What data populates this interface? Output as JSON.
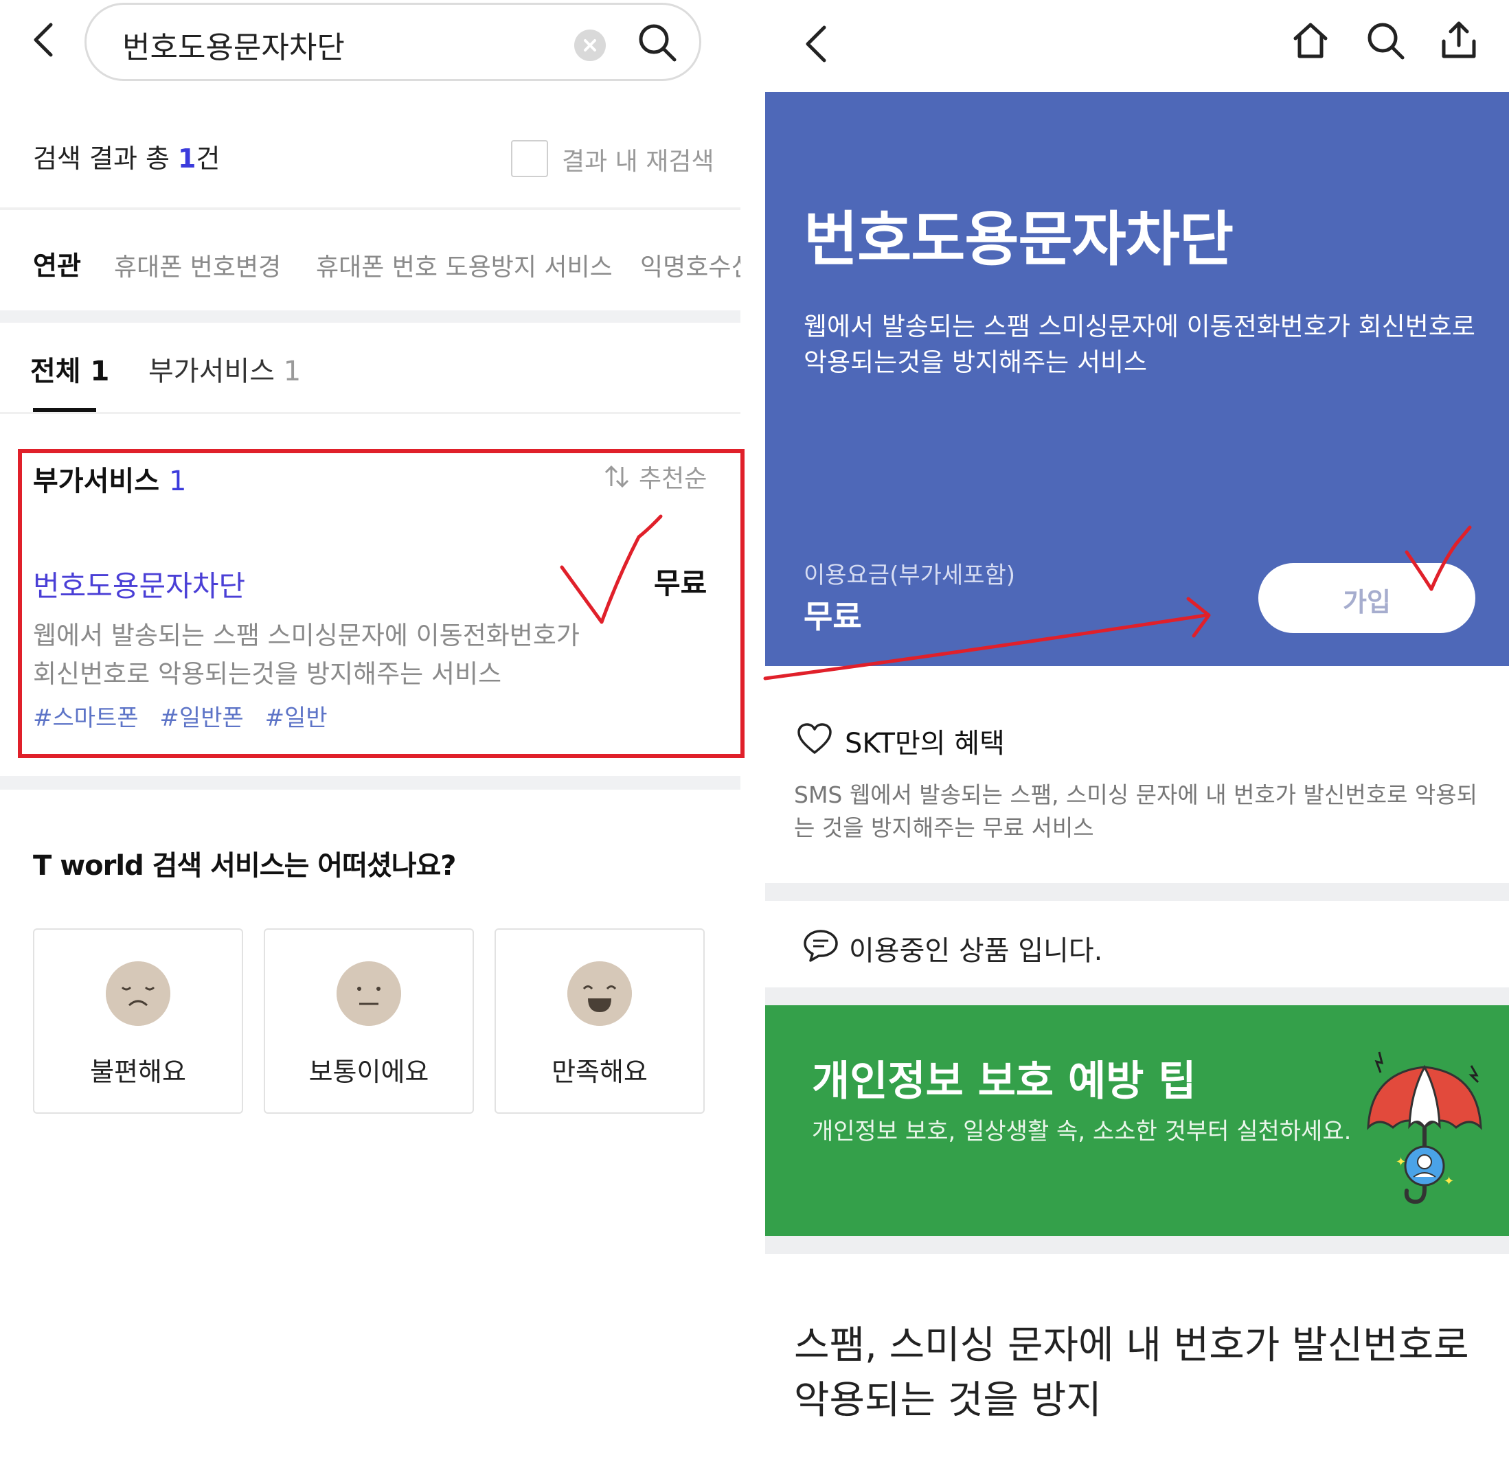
{
  "left": {
    "search": {
      "query": "번호도용문자차단"
    },
    "results": {
      "prefix": "검색 결과 총 ",
      "count": "1",
      "suffix": "건",
      "refine_label": "결과 내 재검색"
    },
    "related": {
      "title": "연관",
      "tags": [
        "휴대폰 번호변경",
        "휴대폰 번호 도용방지 서비스",
        "익명호수신"
      ]
    },
    "tabs": [
      {
        "label": "전체 1"
      },
      {
        "label": "부가서비스",
        "count": "1"
      }
    ],
    "section": {
      "title": "부가서비스",
      "count": "1",
      "sort_label": "추천순",
      "item": {
        "title": "번호도용문자차단",
        "price": "무료",
        "desc": "웹에서 발송되는 스팸 스미싱문자에 이동전화번호가 회신번호로 악용되는것을 방지해주는 서비스",
        "hashtags": [
          "#스마트폰",
          "#일반폰",
          "#일반"
        ]
      }
    },
    "survey": {
      "question": "T world 검색 서비스는 어떠셨나요?",
      "options": [
        {
          "label": "불편해요"
        },
        {
          "label": "보통이에요"
        },
        {
          "label": "만족해요"
        }
      ]
    }
  },
  "right": {
    "hero": {
      "title": "번호도용문자차단",
      "desc": "웹에서 발송되는 스팸 스미싱문자에 이동전화번호가 회신번호로 악용되는것을 방지해주는 서비스",
      "fee_label": "이용요금(부가세포함)",
      "fee_value": "무료",
      "join_label": "가입",
      "bg_color": "#4e68b8"
    },
    "benefit": {
      "title": "SKT만의 혜택",
      "desc": "SMS 웹에서 발송되는 스팸, 스미싱 문자에 내 번호가 발신번호로 악용되는 것을 방지해주는 무료 서비스"
    },
    "in_use": "이용중인 상품 입니다.",
    "tip": {
      "title": "개인정보 보호 예방 팁",
      "desc": "개인정보 보호, 일상생활 속, 소소한 것부터 실천하세요.",
      "bg_color": "#34a04a"
    },
    "bottom_text": "스팸, 스미싱 문자에 내 번호가 발신번호로 악용되는 것을 방지"
  }
}
